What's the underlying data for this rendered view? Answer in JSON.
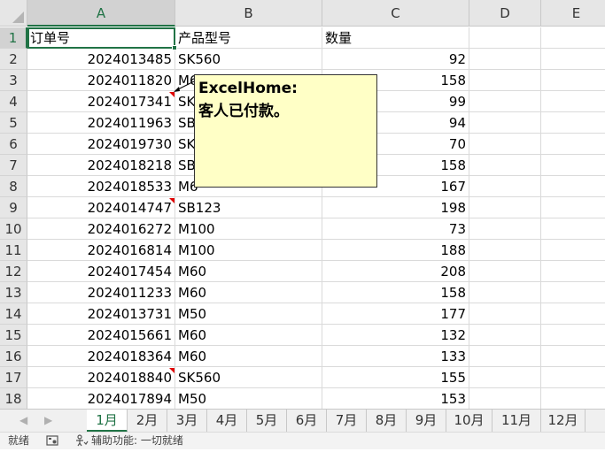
{
  "columns": [
    "A",
    "B",
    "C",
    "D",
    "E"
  ],
  "selected_column": "A",
  "rows": [
    {
      "n": "1",
      "a": "订单号",
      "b": "产品型号",
      "c": "数量"
    },
    {
      "n": "2",
      "a": "2024013485",
      "b": "SK560",
      "c": "92"
    },
    {
      "n": "3",
      "a": "2024011820",
      "b": "M6",
      "c": "158"
    },
    {
      "n": "4",
      "a": "2024017341",
      "b": "SK",
      "c": "99"
    },
    {
      "n": "5",
      "a": "2024011963",
      "b": "SB",
      "c": "94"
    },
    {
      "n": "6",
      "a": "2024019730",
      "b": "SK",
      "c": "70"
    },
    {
      "n": "7",
      "a": "2024018218",
      "b": "SB",
      "c": "158"
    },
    {
      "n": "8",
      "a": "2024018533",
      "b": "M6",
      "c": "167"
    },
    {
      "n": "9",
      "a": "2024014747",
      "b": "SB123",
      "c": "198"
    },
    {
      "n": "10",
      "a": "2024016272",
      "b": "M100",
      "c": "73"
    },
    {
      "n": "11",
      "a": "2024016814",
      "b": "M100",
      "c": "188"
    },
    {
      "n": "12",
      "a": "2024017454",
      "b": "M60",
      "c": "208"
    },
    {
      "n": "13",
      "a": "2024011233",
      "b": "M60",
      "c": "158"
    },
    {
      "n": "14",
      "a": "2024013731",
      "b": "M50",
      "c": "177"
    },
    {
      "n": "15",
      "a": "2024015661",
      "b": "M60",
      "c": "132"
    },
    {
      "n": "16",
      "a": "2024018364",
      "b": "M60",
      "c": "133"
    },
    {
      "n": "17",
      "a": "2024018840",
      "b": "SK560",
      "c": "155"
    },
    {
      "n": "18",
      "a": "2024017894",
      "b": "M50",
      "c": "153"
    }
  ],
  "comment_rows": [
    "4",
    "9",
    "17"
  ],
  "comment": {
    "author": "ExcelHome:",
    "text": "客人已付款。"
  },
  "sheet_tabs": [
    "1月",
    "2月",
    "3月",
    "4月",
    "5月",
    "6月",
    "7月",
    "8月",
    "9月",
    "10月",
    "11月",
    "12月"
  ],
  "active_tab": "1月",
  "status": {
    "ready": "就绪",
    "accessibility": "辅助功能: 一切就绪"
  },
  "icons": {
    "prev": "triangle-left-icon",
    "next": "triangle-right-icon",
    "macro": "macro-record-icon",
    "accessibility": "accessibility-icon"
  },
  "colors": {
    "accent": "#217346",
    "comment_bg": "#ffffc6",
    "comment_marker": "#e00000"
  }
}
